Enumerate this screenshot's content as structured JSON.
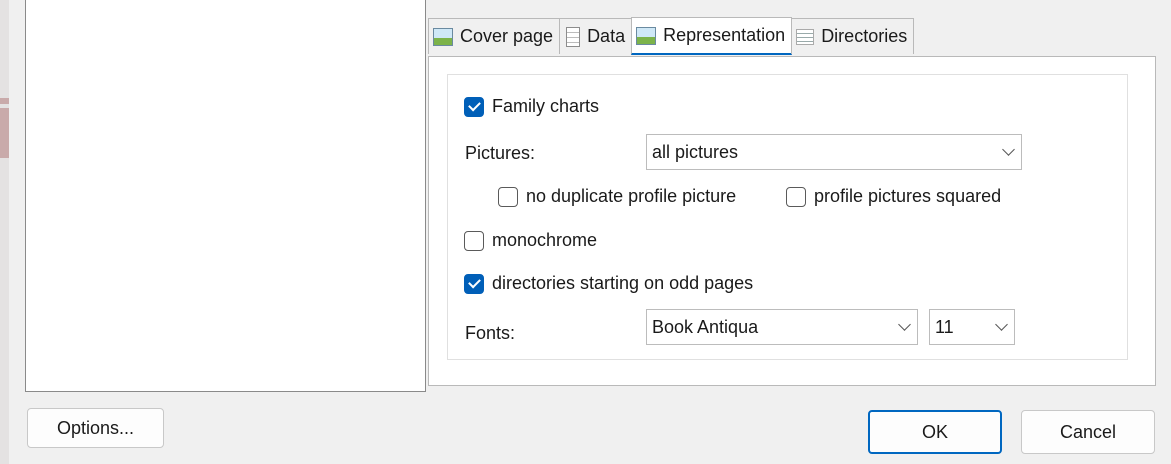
{
  "tabs": [
    {
      "label": "Cover page",
      "icon": "image-icon"
    },
    {
      "label": "Data",
      "icon": "document-icon"
    },
    {
      "label": "Representation",
      "icon": "image-icon",
      "active": true
    },
    {
      "label": "Directories",
      "icon": "list-icon"
    }
  ],
  "representation": {
    "family_charts": {
      "label": "Family charts",
      "checked": true
    },
    "pictures": {
      "label": "Pictures:",
      "value": "all pictures"
    },
    "no_duplicate": {
      "label": "no duplicate profile picture",
      "checked": false
    },
    "squared": {
      "label": "profile pictures squared",
      "checked": false
    },
    "monochrome": {
      "label": "monochrome",
      "checked": false
    },
    "odd_pages": {
      "label": "directories starting on odd pages",
      "checked": true
    },
    "fonts": {
      "label": "Fonts:",
      "family": "Book Antiqua",
      "size": "11"
    }
  },
  "buttons": {
    "options": "Options...",
    "ok": "OK",
    "cancel": "Cancel"
  },
  "colors": {
    "accent": "#0067c0",
    "checkbox_fill": "#005fb8"
  }
}
